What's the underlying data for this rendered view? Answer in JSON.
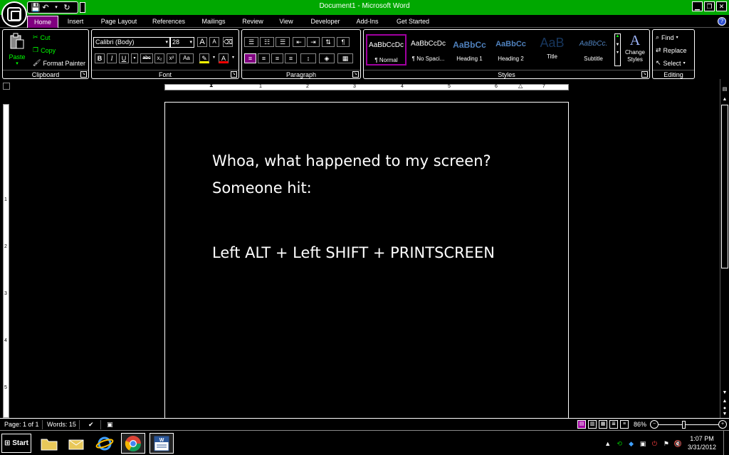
{
  "window": {
    "title": "Document1 - Microsoft Word",
    "controls": {
      "minimize": "▁",
      "restore": "❐",
      "close": "✕"
    }
  },
  "quick_access": {
    "save": "💾",
    "undo": "↶",
    "redo": "↻"
  },
  "tabs": [
    "Home",
    "Insert",
    "Page Layout",
    "References",
    "Mailings",
    "Review",
    "View",
    "Developer",
    "Add-Ins",
    "Get Started"
  ],
  "ribbon": {
    "clipboard": {
      "label": "Clipboard",
      "paste": "Paste",
      "cut": "Cut",
      "copy": "Copy",
      "format_painter": "Format Painter"
    },
    "font": {
      "label": "Font",
      "font_name": "Calibri (Body)",
      "font_size": "28",
      "grow": "A",
      "shrink": "A",
      "bold": "B",
      "italic": "I",
      "underline": "U",
      "strike": "abc",
      "subscript": "x₂",
      "superscript": "x²",
      "change_case": "Aa",
      "font_color": "A"
    },
    "paragraph": {
      "label": "Paragraph",
      "pilcrow": "¶"
    },
    "styles": {
      "label": "Styles",
      "items": [
        {
          "sample": "AaBbCcDc",
          "name": "¶ Normal"
        },
        {
          "sample": "AaBbCcDc",
          "name": "¶ No Spaci..."
        },
        {
          "sample": "AaBbCc",
          "name": "Heading 1"
        },
        {
          "sample": "AaBbCc",
          "name": "Heading 2"
        },
        {
          "sample": "AaB",
          "name": "Title"
        },
        {
          "sample": "AaBbCc.",
          "name": "Subtitle"
        }
      ],
      "change_styles": "Change Styles"
    },
    "editing": {
      "label": "Editing",
      "find": "Find",
      "replace": "Replace",
      "select": "Select"
    }
  },
  "ruler": {
    "h_marks": [
      "1",
      "2",
      "3",
      "4",
      "5",
      "6",
      "7"
    ],
    "v_marks": [
      "1",
      "2",
      "3",
      "4",
      "5"
    ]
  },
  "document": {
    "lines": [
      "Whoa, what happened to my screen?",
      "Someone hit:",
      "Left ALT + Left SHIFT + PRINTSCREEN"
    ]
  },
  "status": {
    "page": "Page: 1 of 1",
    "words": "Words: 15",
    "zoom": "86%"
  },
  "taskbar": {
    "start": "Start",
    "time": "1:07 PM",
    "date": "3/31/2012"
  },
  "colors": {
    "title_green": "#00a800",
    "accent_purple": "#800080"
  }
}
